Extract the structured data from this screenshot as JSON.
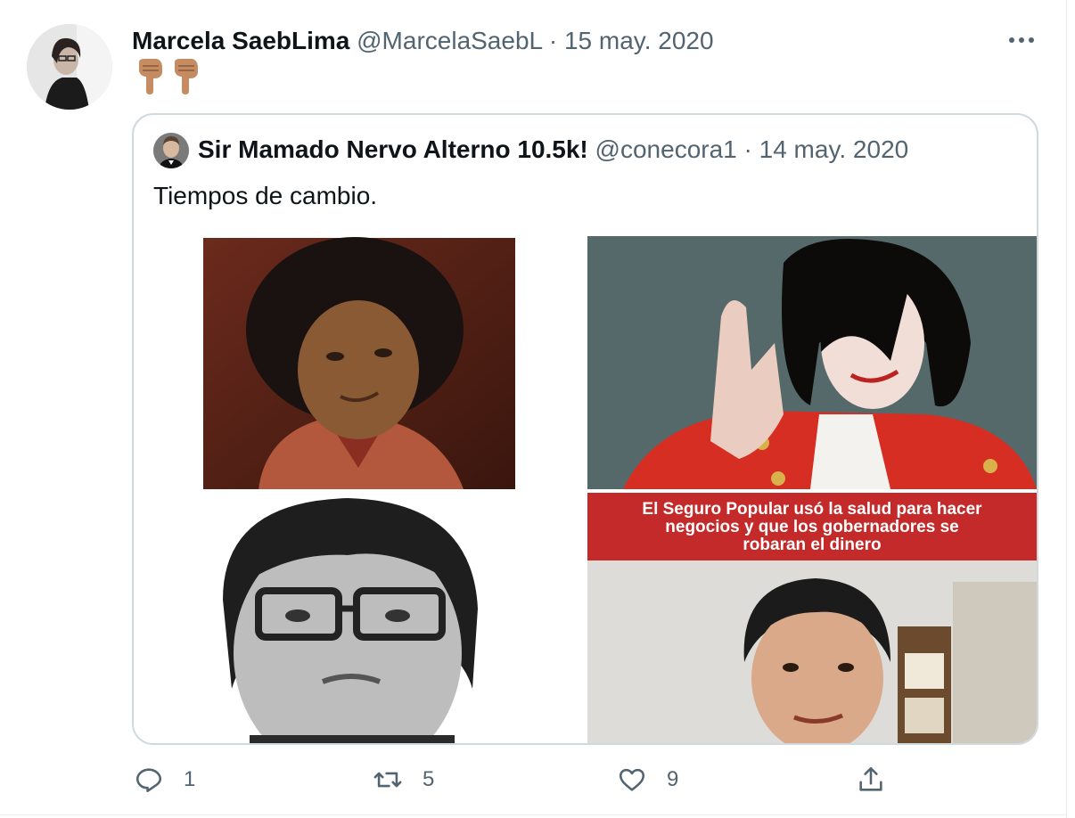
{
  "tweet": {
    "author_name": "Marcela SaebLima",
    "author_handle": "@MarcelaSaebL",
    "separator": "·",
    "date": "15 may. 2020",
    "text_emojis": [
      "👇🏽",
      "👇🏽"
    ]
  },
  "quoted": {
    "author_name": "Sir Mamado Nervo Alterno 10.5k!",
    "author_handle": "@conecora1",
    "separator": "·",
    "date": "14 may. 2020",
    "text": "Tiempos de cambio.",
    "media": [
      {
        "description_icon": "photo-afro-boy"
      },
      {
        "description_icon": "photo-red-jacket-waving"
      },
      {
        "description_icon": "photo-bw-glasses-portrait"
      },
      {
        "description_icon": "photo-video-banner",
        "banner_lines": [
          "El Seguro Popular usó la salud para hacer",
          "negocios y que los gobernadores se",
          "robaran el dinero"
        ]
      }
    ]
  },
  "actions": {
    "reply_count": "1",
    "retweet_count": "5",
    "like_count": "9"
  },
  "colors": {
    "secondary_text": "#536471",
    "border": "#cfd9de",
    "banner_red": "#c52a2a"
  }
}
